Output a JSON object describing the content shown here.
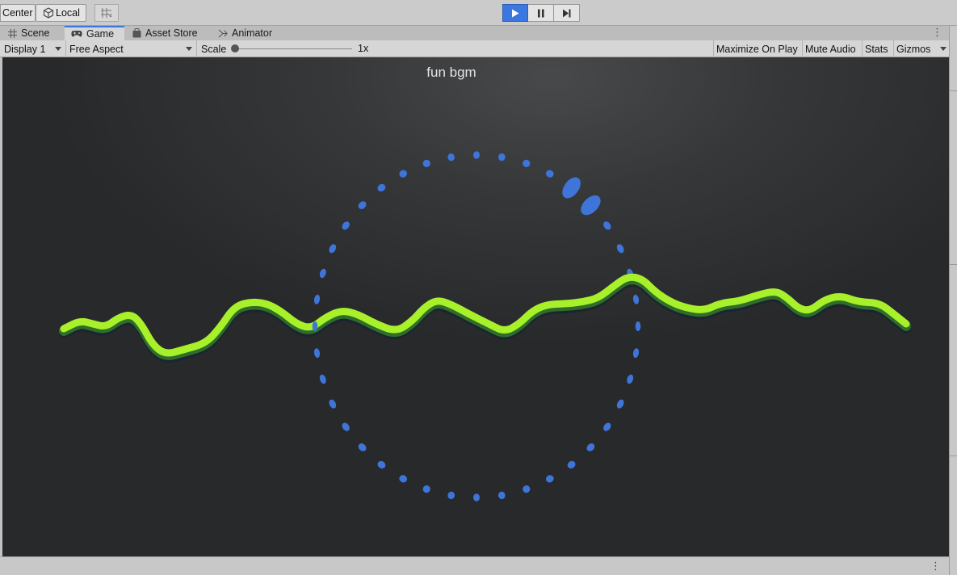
{
  "toolbar": {
    "center_label": "Center",
    "local_label": "Local"
  },
  "tabs": [
    {
      "label": "Scene",
      "icon": "grid-icon"
    },
    {
      "label": "Game",
      "icon": "gamepad-icon",
      "active": true
    },
    {
      "label": "Asset Store",
      "icon": "bag-icon"
    },
    {
      "label": "Animator",
      "icon": "animator-icon"
    }
  ],
  "game_bar": {
    "display": "Display 1",
    "aspect": "Free Aspect",
    "scale_label": "Scale",
    "scale_value": "1x",
    "maximize_on_play": "Maximize On Play",
    "mute_audio": "Mute Audio",
    "stats": "Stats",
    "gizmos": "Gizmos"
  },
  "game_view": {
    "title": "fun bgm",
    "wave_color": "#a8f02a",
    "wave_shadow_color": "#2e6e2a",
    "ring_color": "#3f74d8"
  },
  "colors": {
    "accent": "#3a78e0",
    "viewport_bg": "#2c2e30"
  }
}
